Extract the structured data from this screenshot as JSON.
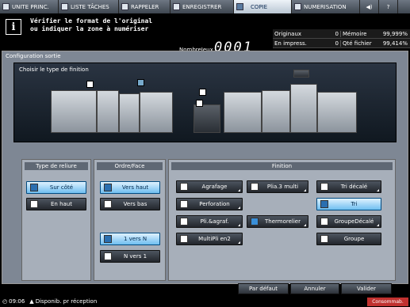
{
  "tabs": [
    {
      "label": "UNITE PRINC.",
      "icon": "home-icon"
    },
    {
      "label": "LISTE TÂCHES",
      "icon": "job-list-icon"
    },
    {
      "label": "RAPPELER",
      "icon": "recall-icon"
    },
    {
      "label": "ENREGISTRER",
      "icon": "store-icon"
    },
    {
      "label": "COPIE",
      "icon": "copy-icon"
    },
    {
      "label": "NUMERISATION",
      "icon": "scan-icon"
    }
  ],
  "message": {
    "line1": "Vérifier le format de l'original",
    "line2": "ou indiquer la zone à numériser"
  },
  "copies": {
    "label": "NombreJeux",
    "value": "0001"
  },
  "status": {
    "originals_label": "Originaux",
    "originals_val": "0",
    "memory_label": "Mémoire",
    "memory_val": "99,999%",
    "printing_label": "En impress.",
    "printing_val": "0",
    "file_label": "Qté fichier",
    "file_val": "99,414%"
  },
  "screen_title": "Configuration sortie",
  "machine_label": "Choisir le type de finition",
  "binding": {
    "title": "Type de reliure",
    "options": [
      "Sur côté",
      "En haut"
    ],
    "selected": 0
  },
  "order": {
    "title": "Ordre/Face",
    "options": [
      "Vers haut",
      "Vers bas",
      "1 vers N",
      "N vers 1"
    ]
  },
  "finishing": {
    "title": "Finition",
    "buttons": [
      "Agrafage",
      "Plia.3 multi",
      "Tri décalé",
      "Perforation",
      "Tri",
      "Pli.&agraf.",
      "Thermorelier",
      "GroupeDécalé",
      "MultiPli en2",
      "Groupe"
    ]
  },
  "footer": {
    "default": "Par défaut",
    "cancel": "Annuler",
    "ok": "Valider"
  },
  "statusbar": {
    "time": "09:06",
    "ready": "Disponib. pr réception",
    "consumables": "Consommab."
  }
}
